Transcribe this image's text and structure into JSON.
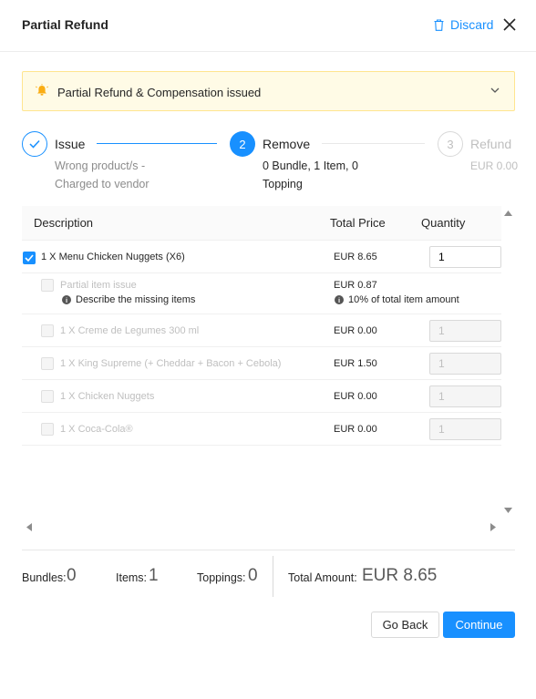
{
  "header": {
    "title": "Partial Refund",
    "discard_label": "Discard"
  },
  "alert": {
    "text": "Partial Refund & Compensation issued"
  },
  "steps": [
    {
      "title": "Issue",
      "status": "finished",
      "desc_line1": "Wrong product/s -",
      "desc_line2": "Charged to vendor"
    },
    {
      "number": "2",
      "title": "Remove",
      "status": "active",
      "desc_line1": "0 Bundle, 1 Item, 0",
      "desc_line2": "Topping"
    },
    {
      "number": "3",
      "title": "Refund",
      "status": "waiting",
      "desc_line1": "EUR 0.00"
    }
  ],
  "table": {
    "columns": [
      "Description",
      "Total Price",
      "Quantity"
    ],
    "rows": [
      {
        "description": "1 X Menu Chicken Nuggets (X6)",
        "price": "EUR 8.65",
        "quantity": "1",
        "checked": true,
        "enabled": true
      },
      {
        "description": "Partial item issue",
        "price": "EUR 0.87",
        "note": "Describe the missing items",
        "price_note": "10% of total item amount",
        "checked": false,
        "enabled": false
      },
      {
        "description": "1 X Creme de Legumes 300 ml",
        "price": "EUR 0.00",
        "quantity": "1",
        "checked": false,
        "enabled": false
      },
      {
        "description": "1 X King Supreme (+ Cheddar + Bacon + Cebola)",
        "price": "EUR 1.50",
        "quantity": "1",
        "checked": false,
        "enabled": false
      },
      {
        "description": "1 X Chicken Nuggets",
        "price": "EUR 0.00",
        "quantity": "1",
        "checked": false,
        "enabled": false
      },
      {
        "description": "1 X Coca-Cola®",
        "price": "EUR 0.00",
        "quantity": "1",
        "checked": false,
        "enabled": false
      }
    ]
  },
  "summary": {
    "bundles_label": "Bundles:",
    "bundles_value": "0",
    "items_label": "Items:",
    "items_value": "1",
    "toppings_label": "Toppings:",
    "toppings_value": "0",
    "total_label": "Total Amount:",
    "total_value": "EUR 8.65"
  },
  "actions": {
    "back_label": "Go Back",
    "continue_label": "Continue"
  },
  "colors": {
    "primary": "#1890ff",
    "alert_bg": "#fffbe6",
    "alert_border": "#ffe58f",
    "bell": "#faad14"
  },
  "icons": [
    "trash-icon",
    "close-icon",
    "bell-icon",
    "chevron-down-icon",
    "check-icon",
    "info-icon",
    "arrow-up-icon",
    "arrow-down-icon",
    "arrow-left-icon",
    "arrow-right-icon"
  ]
}
